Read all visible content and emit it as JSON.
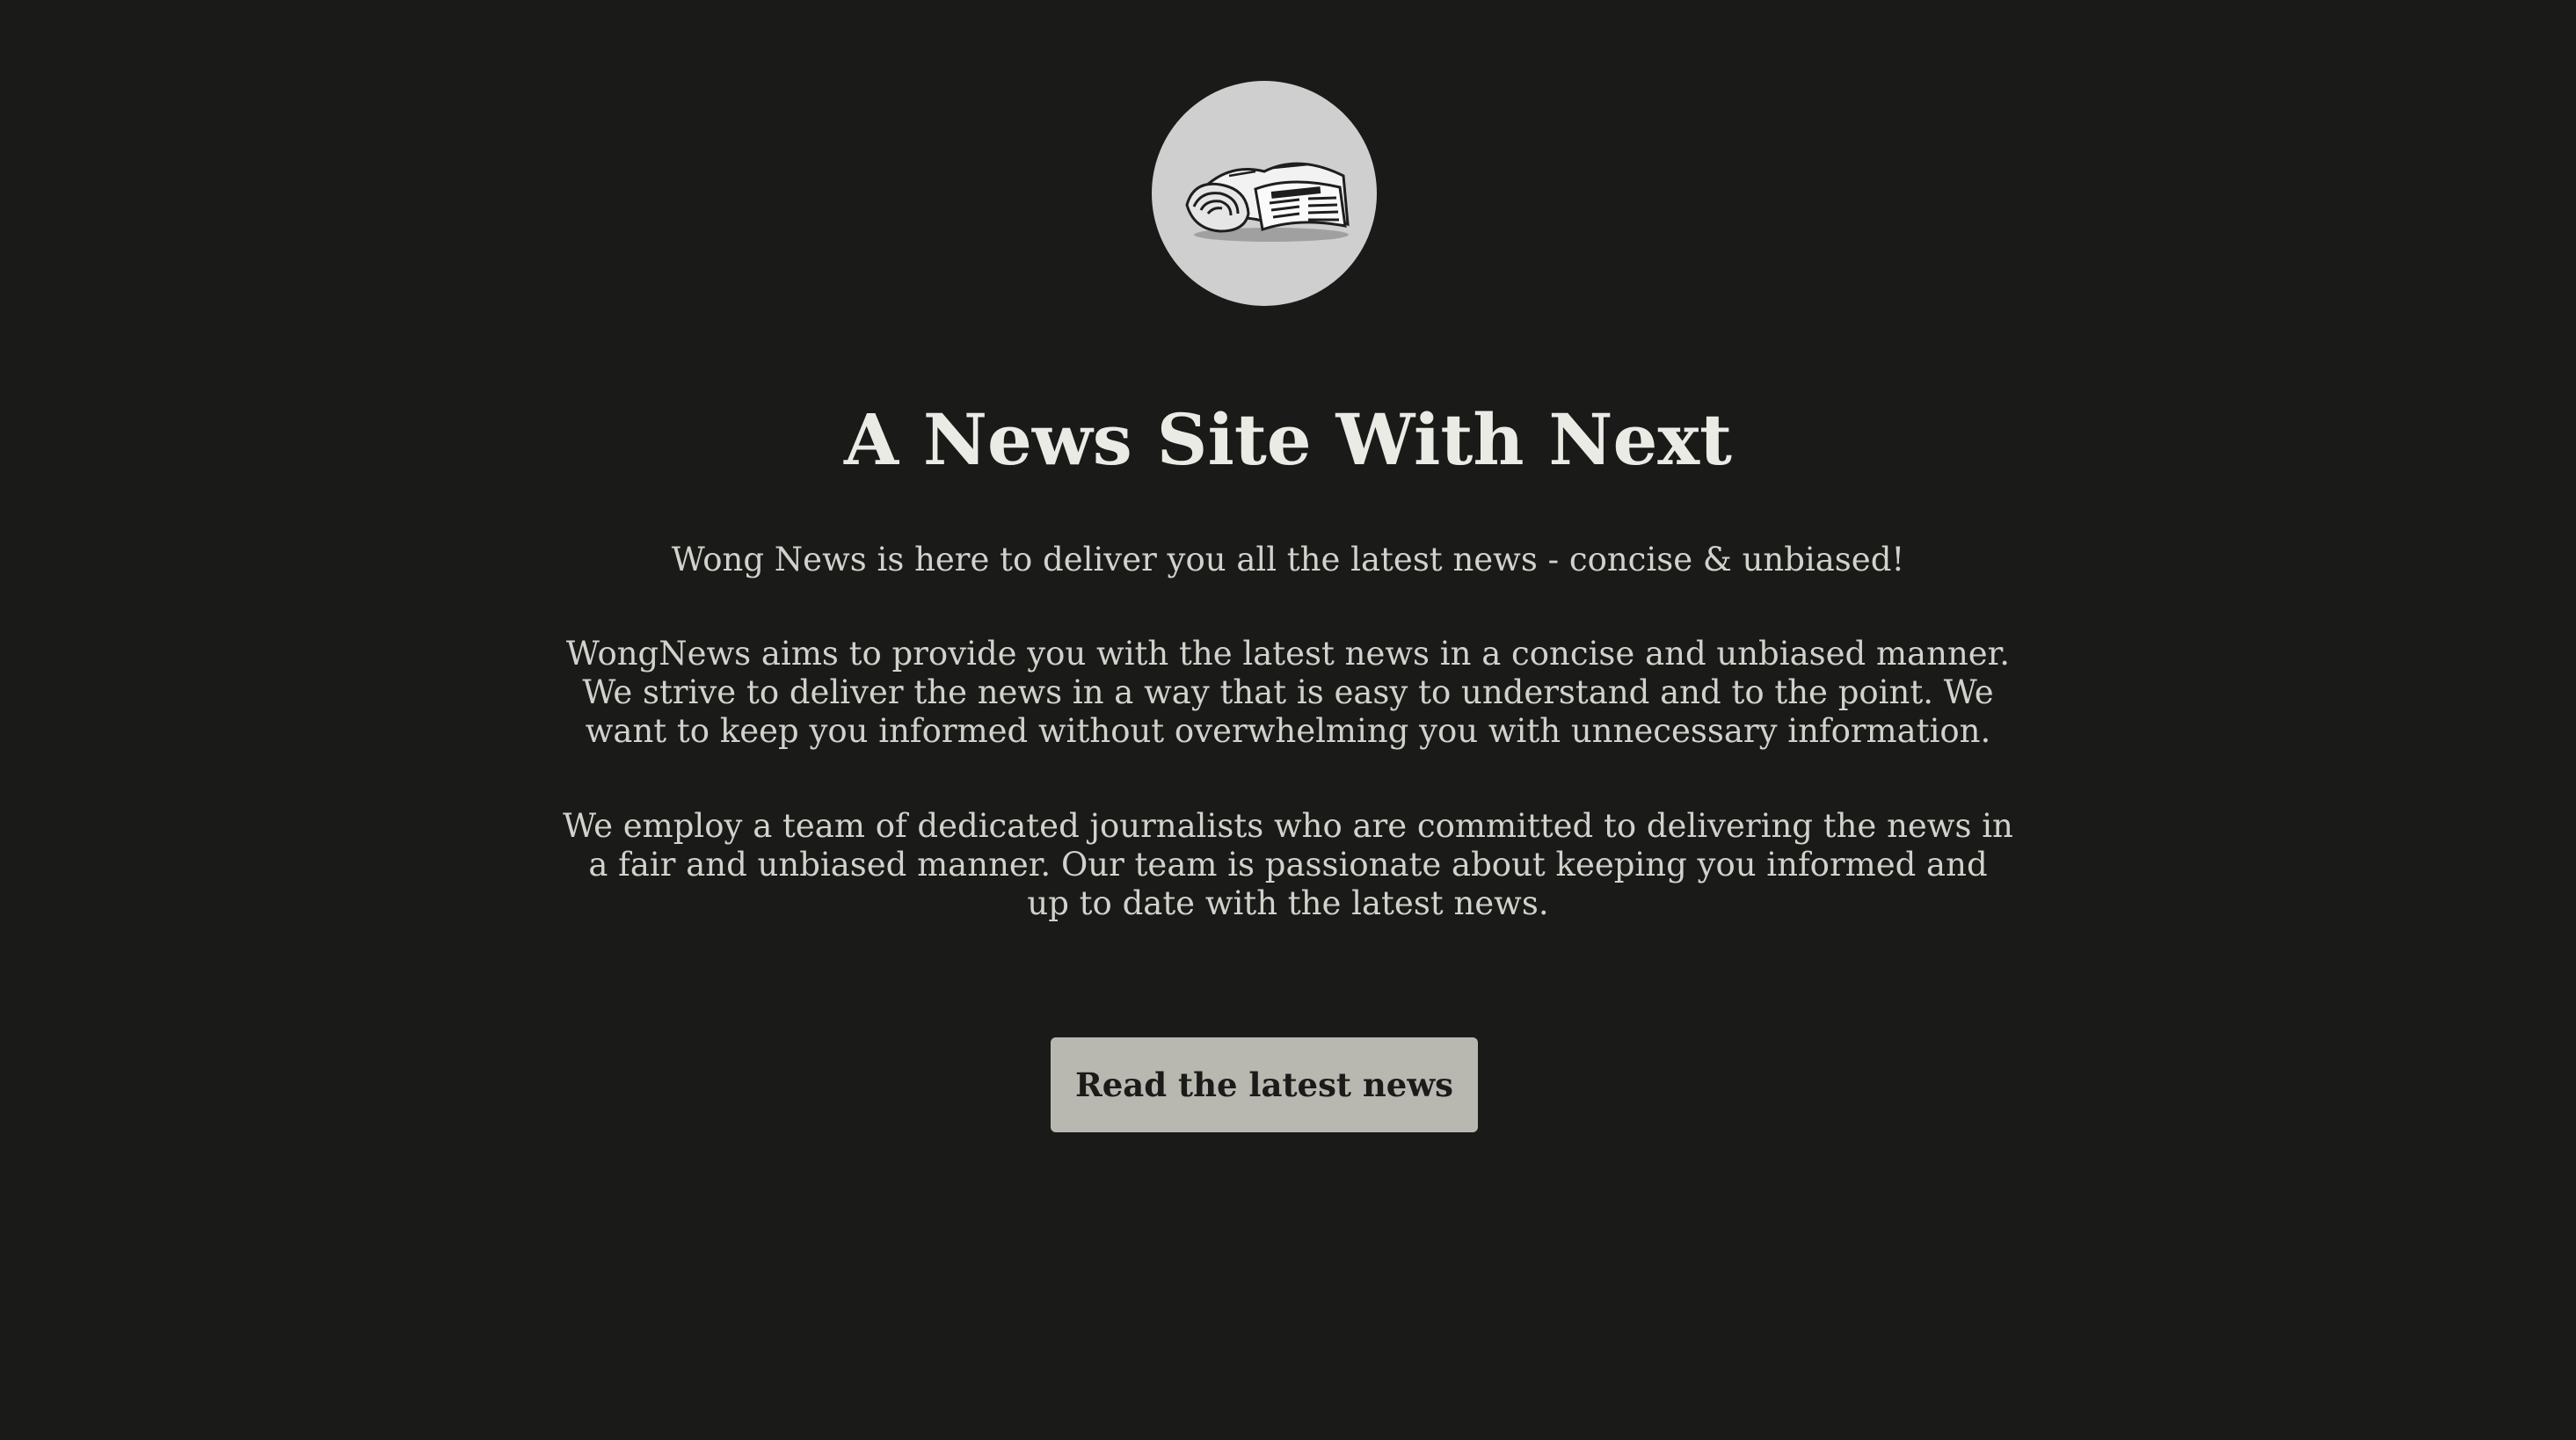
{
  "logo": {
    "icon": "newspaper-icon",
    "background_color": "#cfcfcf"
  },
  "hero": {
    "title": "A News Site With Next",
    "tagline": "Wong News is here to deliver you all the latest news - concise & unbiased!",
    "paragraphs": [
      "WongNews aims to provide you with the latest news in a concise and unbiased manner. We strive to deliver the news in a way that is easy to understand and to the point. We want to keep you informed without overwhelming you with unnecessary information.",
      "We employ a team of dedicated journalists who are committed to delivering the news in a fair and unbiased manner. Our team is passionate about keeping you informed and up to date with the latest news."
    ],
    "cta_label": "Read the latest news"
  },
  "colors": {
    "background": "#1a1a19",
    "text": "#d2d2cc",
    "heading": "#ebebe6",
    "button_bg": "#b8b8b0",
    "button_text": "#1b1b1a"
  }
}
